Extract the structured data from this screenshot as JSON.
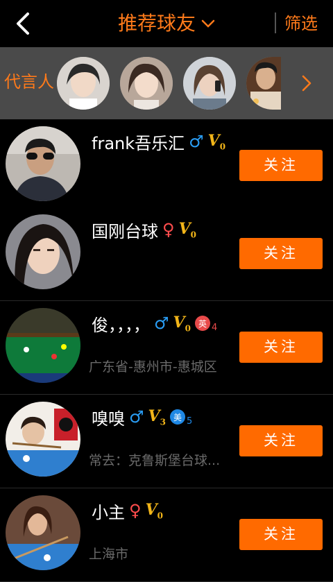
{
  "header": {
    "title": "推荐球友",
    "filter_label": "筛选"
  },
  "spokespersons": {
    "label": "代言人"
  },
  "users": [
    {
      "name": "frank吾乐汇",
      "gender_symbol": "♂",
      "vip": "V",
      "vip_level": "0",
      "badge_text": "",
      "badge_num": "",
      "sub_text": "",
      "follow_label": "关注"
    },
    {
      "name": "国刚台球",
      "gender_symbol": "♀",
      "vip": "V",
      "vip_level": "0",
      "badge_text": "",
      "badge_num": "",
      "sub_text": "",
      "follow_label": "关注"
    },
    {
      "name": "俊，，，，",
      "gender_symbol": "♂",
      "vip": "V",
      "vip_level": "0",
      "badge_text": "英",
      "badge_num": "4",
      "sub_text": "广东省-惠州市-惠城区",
      "follow_label": "关注"
    },
    {
      "name": "嗅嗅",
      "gender_symbol": "♂",
      "vip": "V",
      "vip_level": "3",
      "badge_text": "美",
      "badge_num": "5",
      "sub_text": "常去：克鲁斯堡台球...",
      "follow_label": "关注"
    },
    {
      "name": "小主",
      "gender_symbol": "♀",
      "vip": "V",
      "vip_level": "0",
      "badge_text": "",
      "badge_num": "",
      "sub_text": "上海市",
      "follow_label": "关注"
    }
  ],
  "colors": {
    "accent": "#ff7a1a",
    "follow_bg": "#ff6a00",
    "male": "#2a9df4",
    "female": "#ff4d4d",
    "vip": "#f2b519",
    "badge_red": "#e84a4a",
    "badge_blue": "#1e88e5"
  }
}
